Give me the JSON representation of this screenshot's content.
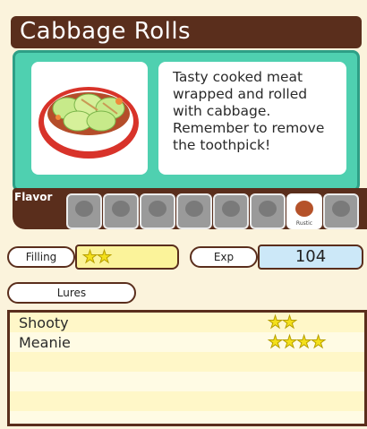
{
  "food": {
    "title": "Cabbage Rolls",
    "description": "Tasty cooked meat wrapped and rolled with cabbage. Remember to remove the toothpick!"
  },
  "flavor": {
    "label": "Flavor",
    "chips": [
      {
        "name": "",
        "active": false
      },
      {
        "name": "",
        "active": false
      },
      {
        "name": "",
        "active": false
      },
      {
        "name": "",
        "active": false
      },
      {
        "name": "",
        "active": false
      },
      {
        "name": "",
        "active": false
      },
      {
        "name": "Rustic",
        "active": true
      },
      {
        "name": "",
        "active": false
      }
    ]
  },
  "stats": {
    "filling_label": "Filling",
    "filling_stars": 2,
    "filling_stars_text": "★★",
    "exp_label": "Exp",
    "exp_value": "104"
  },
  "lures": {
    "label": "Lures",
    "items": [
      {
        "name": "Shooty",
        "stars": 2,
        "stars_text": "★★"
      },
      {
        "name": "Meanie",
        "stars": 4,
        "stars_text": "★★★★"
      }
    ]
  },
  "colors": {
    "title_bar": "#5a2e1c",
    "card_bg": "#4fd0b0",
    "filling_bg": "#fbf39a",
    "exp_bg": "#cce8f8",
    "star": "#f4e01a"
  }
}
